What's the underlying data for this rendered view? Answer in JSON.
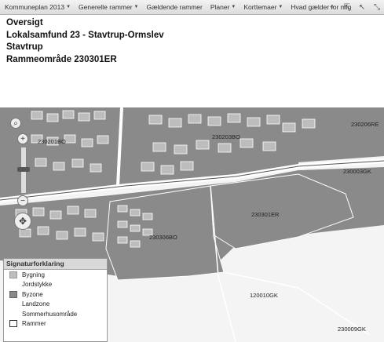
{
  "menu": {
    "items": [
      {
        "label": "Kommuneplan 2013"
      },
      {
        "label": "Generelle rammer"
      },
      {
        "label": "Gældende rammer"
      },
      {
        "label": "Planer"
      },
      {
        "label": "Korttemaer"
      },
      {
        "label": "Hvad gælder for mig"
      }
    ],
    "tools": [
      {
        "icon": "crosshair-icon",
        "glyph": "⌖"
      },
      {
        "icon": "select-icon",
        "glyph": "⇱"
      },
      {
        "icon": "pointer-icon",
        "glyph": "↖"
      },
      {
        "icon": "measure-icon",
        "glyph": "⤡"
      }
    ]
  },
  "header": {
    "line1": "Oversigt",
    "line2": "Lokalsamfund 23 - Stavtrup-Ormslev",
    "line3": "Stavtrup",
    "line4": "Rammeområde 230301ER"
  },
  "map": {
    "labels": {
      "a": "230201BO",
      "b": "230203BO",
      "c": "230206RE",
      "d": "230003GK",
      "e": "230301ER",
      "f": "230306BO",
      "g": "120010GK",
      "h": "230009GK"
    },
    "colors": {
      "byzone": "#8a8a8a",
      "bygning": "#bdbdbd",
      "background": "#f4f4f4"
    }
  },
  "legend": {
    "title": "Signaturforklaring",
    "items": [
      {
        "label": "Bygning",
        "color": "#bdbdbd"
      },
      {
        "label": "Jordstykke",
        "color": "none"
      },
      {
        "label": "Byzone",
        "color": "#8a8a8a"
      },
      {
        "label": "Landzone",
        "color": "none"
      },
      {
        "label": "Sommerhusområde",
        "color": "none"
      },
      {
        "label": "Rammer",
        "color": "#ffffff"
      }
    ]
  }
}
